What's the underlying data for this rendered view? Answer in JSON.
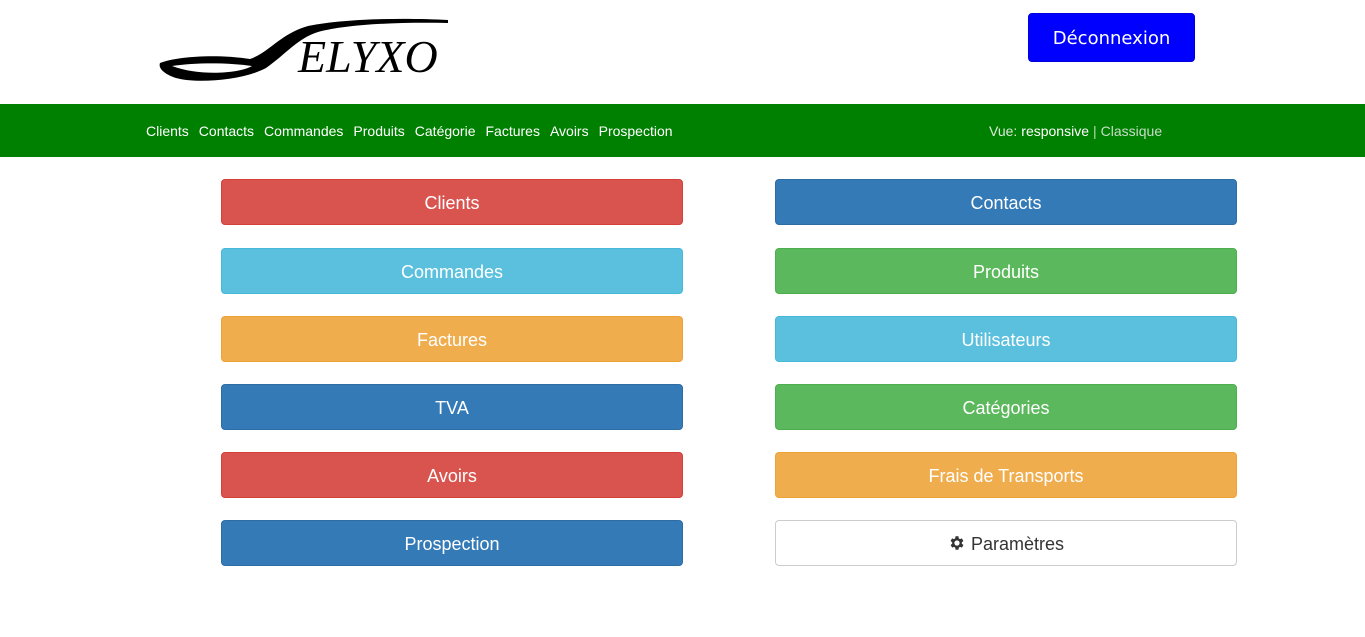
{
  "header": {
    "logo_text": "ELYXO",
    "logout_label": "Déconnexion"
  },
  "nav": {
    "items": [
      "Clients",
      "Contacts",
      "Commandes",
      "Produits",
      "Catégorie",
      "Factures",
      "Avoirs",
      "Prospection"
    ],
    "view_label": "Vue:",
    "view_active": "responsive",
    "view_separator": "|",
    "view_other": "Classique"
  },
  "tiles": {
    "left": [
      "Clients",
      "Commandes",
      "Factures",
      "TVA",
      "Avoirs",
      "Prospection"
    ],
    "right": [
      "Contacts",
      "Produits",
      "Utilisateurs",
      "Catégories",
      "Frais de Transports",
      "Paramètres"
    ]
  },
  "icons": {
    "settings": "gear-icon",
    "logo": "spoon-icon"
  },
  "colors": {
    "navbar": "#008000",
    "logout": "#0000ff",
    "danger": "#d9534f",
    "primary": "#337ab7",
    "info": "#5bc0de",
    "success": "#5cb85c",
    "warning": "#f0ad4e"
  }
}
